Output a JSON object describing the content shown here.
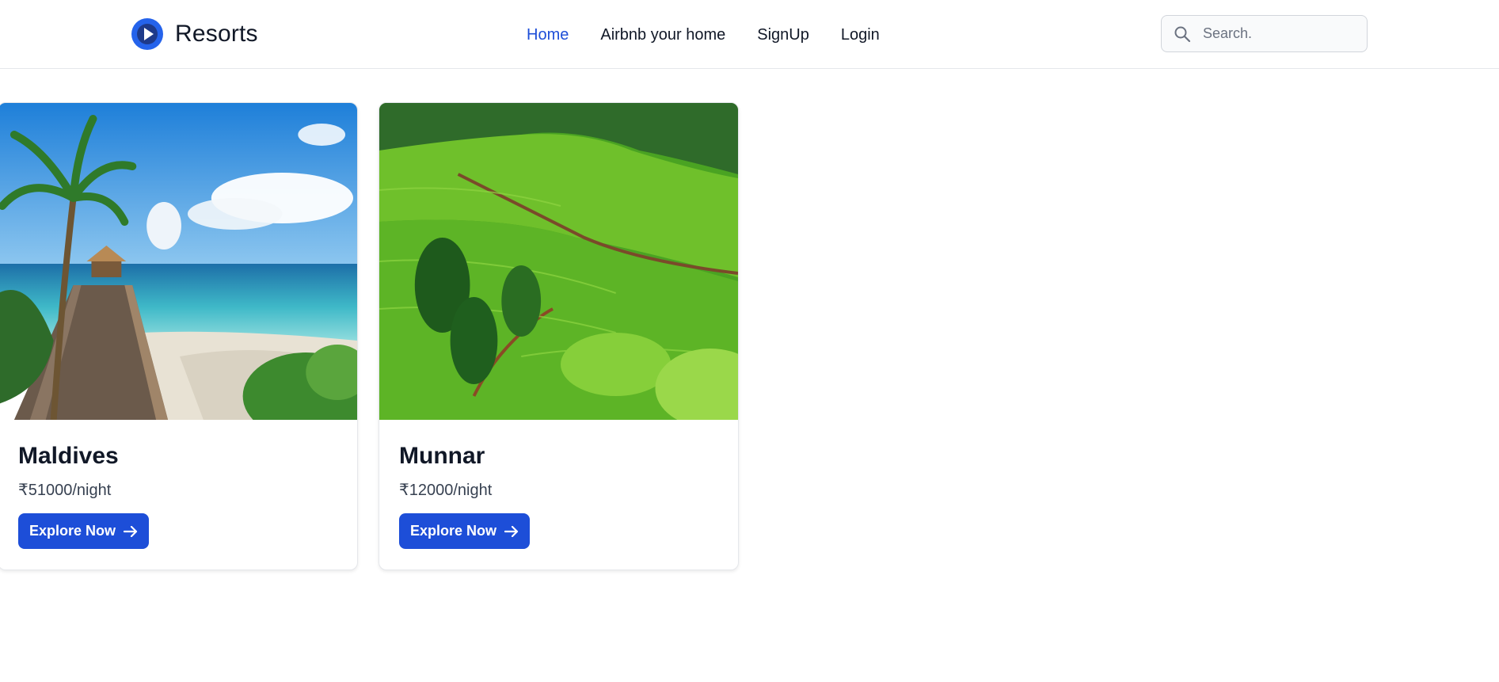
{
  "brand": {
    "name": "Resorts",
    "logo_icon": "play-circle-icon",
    "accent": "#1d4ed8"
  },
  "nav": {
    "items": [
      {
        "label": "Home",
        "active": true
      },
      {
        "label": "Airbnb your home",
        "active": false
      },
      {
        "label": "SignUp",
        "active": false
      },
      {
        "label": "Login",
        "active": false
      }
    ]
  },
  "search": {
    "placeholder": "Search.",
    "value": "",
    "icon": "search-icon"
  },
  "listings": [
    {
      "title": "Maldives",
      "price": "₹51000/night",
      "button_label": "Explore Now",
      "button_icon": "arrow-right-icon",
      "image": "beach-boardwalk-photo"
    },
    {
      "title": "Munnar",
      "price": "₹12000/night",
      "button_label": "Explore Now",
      "button_icon": "arrow-right-icon",
      "image": "tea-hills-photo"
    }
  ],
  "colors": {
    "primary": "#1d4ed8",
    "text": "#111827",
    "border": "#e5e7eb"
  }
}
